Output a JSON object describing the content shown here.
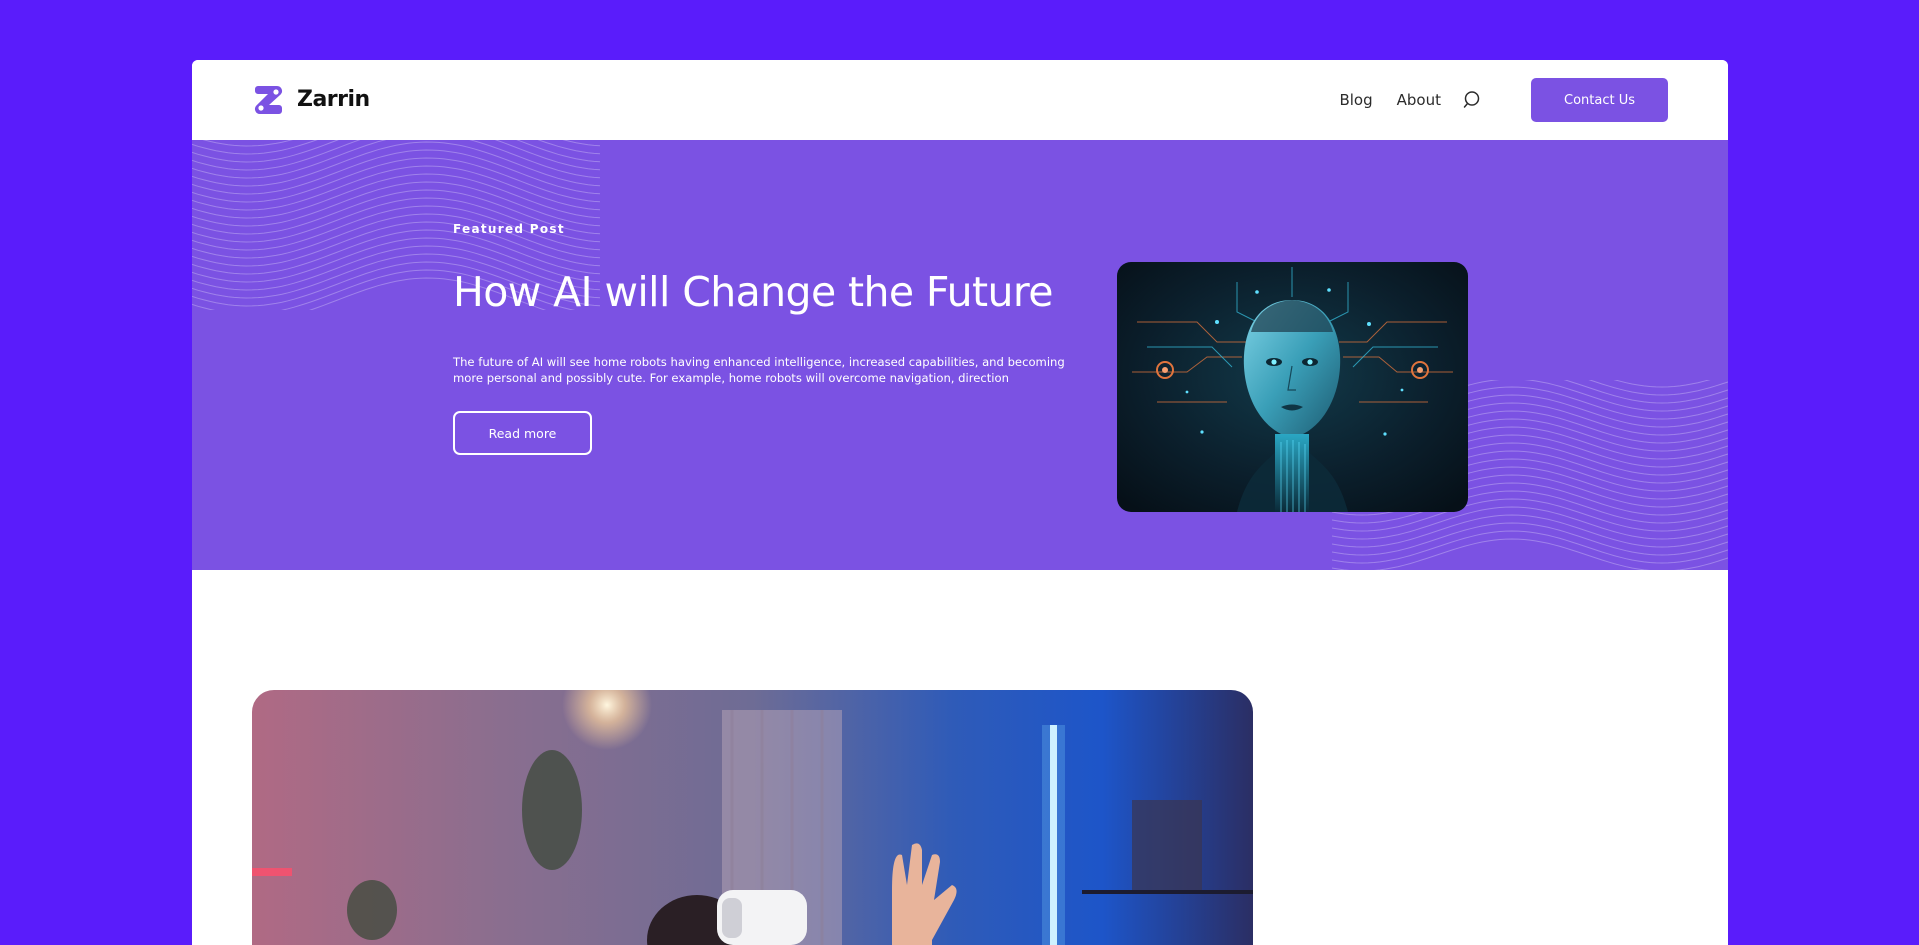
{
  "brand": {
    "name": "Zarrin",
    "icon": "zarrin-logo-mark",
    "accent_color": "#7b52e3",
    "page_background": "#5a1cfb"
  },
  "nav": {
    "links": [
      "Blog",
      "About"
    ],
    "search_icon": "search-icon",
    "contact_label": "Contact Us"
  },
  "hero": {
    "eyebrow": "Featured Post",
    "title": "How AI will Change the Future",
    "description": "The future of AI will see home robots having enhanced intelligence, increased capabilities, and becoming more personal and possibly cute. For example, home robots will overcome navigation, direction",
    "cta_label": "Read more",
    "image": "ai-woman-face-circuit-illustration"
  },
  "posts": [
    {
      "image": "person-wearing-vr-headset-neon-room"
    }
  ]
}
